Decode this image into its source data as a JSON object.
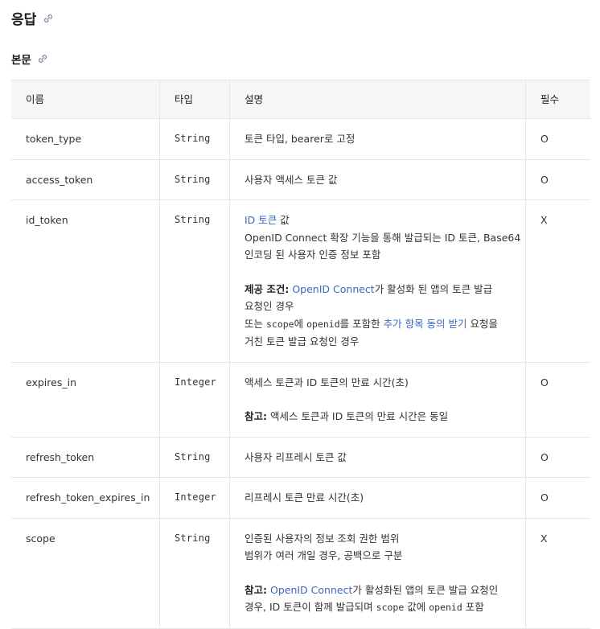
{
  "section_title": "응답",
  "subsection_title": "본문",
  "table": {
    "headers": [
      "이름",
      "타입",
      "설명",
      "필수"
    ],
    "rows": [
      {
        "name": "token_type",
        "type": "String",
        "desc": [
          "토큰 타입, bearer로 고정"
        ],
        "required": "O"
      },
      {
        "name": "access_token",
        "type": "String",
        "desc": [
          "사용자 액세스 토큰 값"
        ],
        "required": "O"
      },
      {
        "name": "id_token",
        "type": "String",
        "desc_link": "ID 토큰",
        "desc_after_link": " 값",
        "desc_lines": [
          "OpenID Connect 확장 기능을 통해 발급되는 ID 토큰, Base64",
          "인코딩 된 사용자 인증 정보 포함"
        ],
        "cond_label": "제공 조건:",
        "cond_link": "OpenID Connect",
        "cond_text": "가 활성화 된 앱의 토큰 발급",
        "cond_line2": "요청인 경우",
        "or_pre": "또는 ",
        "or_code1": "scope",
        "or_mid": "에 ",
        "or_code2": "openid",
        "or_mid2": "를 포함한 ",
        "or_link": "추가 항목 동의 받기",
        "or_post": " 요청을",
        "or_line2": "거친 토큰 발급 요청인 경우",
        "required": "X"
      },
      {
        "name": "expires_in",
        "type": "Integer",
        "desc": [
          "액세스 토큰과 ID 토큰의 만료 시간(초)"
        ],
        "note_label": "참고:",
        "note": " 액세스 토큰과 ID 토큰의 만료 시간은 동일",
        "required": "O"
      },
      {
        "name": "refresh_token",
        "type": "String",
        "desc": [
          "사용자 리프레시 토큰 값"
        ],
        "required": "O"
      },
      {
        "name": "refresh_token_expires_in",
        "type": "Integer",
        "desc": [
          "리프레시 토큰 만료 시간(초)"
        ],
        "required": "O"
      },
      {
        "name": "scope",
        "type": "String",
        "desc": [
          "인증된 사용자의 정보 조회 권한 범위",
          "범위가 여러 개일 경우, 공백으로 구분"
        ],
        "note_label": "참고:",
        "note_link": "OpenID Connect",
        "note_text": "가 활성화된 앱의 토큰 발급 요청인",
        "note_line2_pre": "경우, ID 토큰이 함께 발급되며 ",
        "note_code1": "scope",
        "note_mid": " 값에 ",
        "note_code2": "openid",
        "note_post": " 포함",
        "required": "X"
      }
    ]
  },
  "colors": {
    "link": "#3b64d9",
    "header_bg": "#f5f6f8",
    "border": "#e6e6e6"
  }
}
